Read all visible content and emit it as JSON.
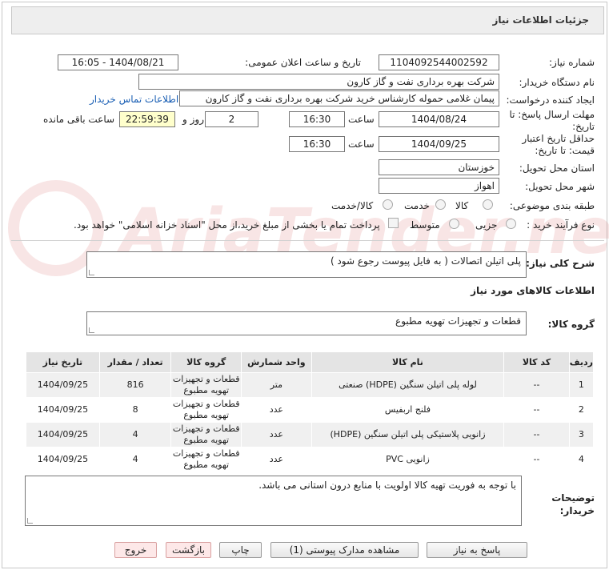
{
  "header": {
    "title": "جزئیات اطلاعات نیاز"
  },
  "watermark": {
    "text": "AriaTender.net"
  },
  "fields": {
    "need_number_label": "شماره نیاز:",
    "need_number": "1104092544002592",
    "announce_label": "تاریخ و ساعت اعلان عمومی:",
    "announce_value": "1404/08/21 - 16:05",
    "buyer_org_label": "نام دستگاه خریدار:",
    "buyer_org": "شرکت بهره برداری نفت و گاز کارون",
    "creator_label": "ایجاد کننده درخواست:",
    "creator": "پیمان غلامی حموله کارشناس خرید شرکت بهره برداری نفت و گاز کارون",
    "contact_link": "اطلاعات تماس خریدار",
    "deadline_label": "مهلت ارسال پاسخ: تا تاریخ:",
    "deadline_date": "1404/08/24",
    "time_label": "ساعت",
    "deadline_time": "16:30",
    "days_value": "2",
    "days_label": "روز و",
    "remaining_time": "22:59:39",
    "remaining_label": "ساعت باقی مانده",
    "validity_label": "حداقل تاریخ اعتبار قیمت: تا تاریخ:",
    "validity_date": "1404/09/25",
    "validity_time": "16:30",
    "province_label": "استان محل تحویل:",
    "province": "خوزستان",
    "city_label": "شهر محل تحویل:",
    "city": "اهواز",
    "category_label": "طبقه بندی موضوعی:",
    "category_options": [
      "کالا",
      "خدمت",
      "کالا/خدمت"
    ],
    "purchase_type_label": "نوع فرآیند خرید :",
    "purchase_options": [
      "جزیی",
      "متوسط"
    ],
    "treasury_note": "پرداخت تمام یا بخشی از مبلغ خرید،از محل \"اسناد خزانه اسلامی\" خواهد بود."
  },
  "summary": {
    "label": "شرح کلی نیاز:",
    "text": "پلی اتیلن اتصالات ( به فایل پیوست رجوع شود )"
  },
  "goods_section": {
    "title": "اطلاعات کالاهای مورد نیاز"
  },
  "goods_group": {
    "label": "گروه کالا:",
    "value": "قطعات و تجهیزات تهویه مطبوع"
  },
  "table": {
    "headers": [
      "ردیف",
      "کد کالا",
      "نام کالا",
      "واحد شمارش",
      "گروه کالا",
      "تعداد / مقدار",
      "تاریخ نیاز"
    ],
    "rows": [
      {
        "idx": "1",
        "code": "--",
        "name": "لوله پلی اتیلن سنگین (HDPE) صنعتی",
        "unit": "متر",
        "group": "قطعات و تجهیزات تهویه مطبوع",
        "qty": "816",
        "date": "1404/09/25"
      },
      {
        "idx": "2",
        "code": "--",
        "name": "فلنج اربفیس",
        "unit": "عدد",
        "group": "قطعات و تجهیزات تهویه مطبوع",
        "qty": "8",
        "date": "1404/09/25"
      },
      {
        "idx": "3",
        "code": "--",
        "name": "زانویی پلاستیکی پلی اتیلن سنگین (HDPE)",
        "unit": "عدد",
        "group": "قطعات و تجهیزات تهویه مطبوع",
        "qty": "4",
        "date": "1404/09/25"
      },
      {
        "idx": "4",
        "code": "--",
        "name": "زانویی PVC",
        "unit": "عدد",
        "group": "قطعات و تجهیزات تهویه مطبوع",
        "qty": "4",
        "date": "1404/09/25"
      }
    ]
  },
  "buyer_notes": {
    "label": "توضیحات خریدار:",
    "text": "با توجه به فوریت تهیه کالا اولویت با منابع درون استانی می باشد."
  },
  "buttons": {
    "reply": "پاسخ به نیاز",
    "docs": "مشاهده مدارک پیوستی (1)",
    "print": "چاپ",
    "back": "بازگشت",
    "exit": "خروج"
  }
}
